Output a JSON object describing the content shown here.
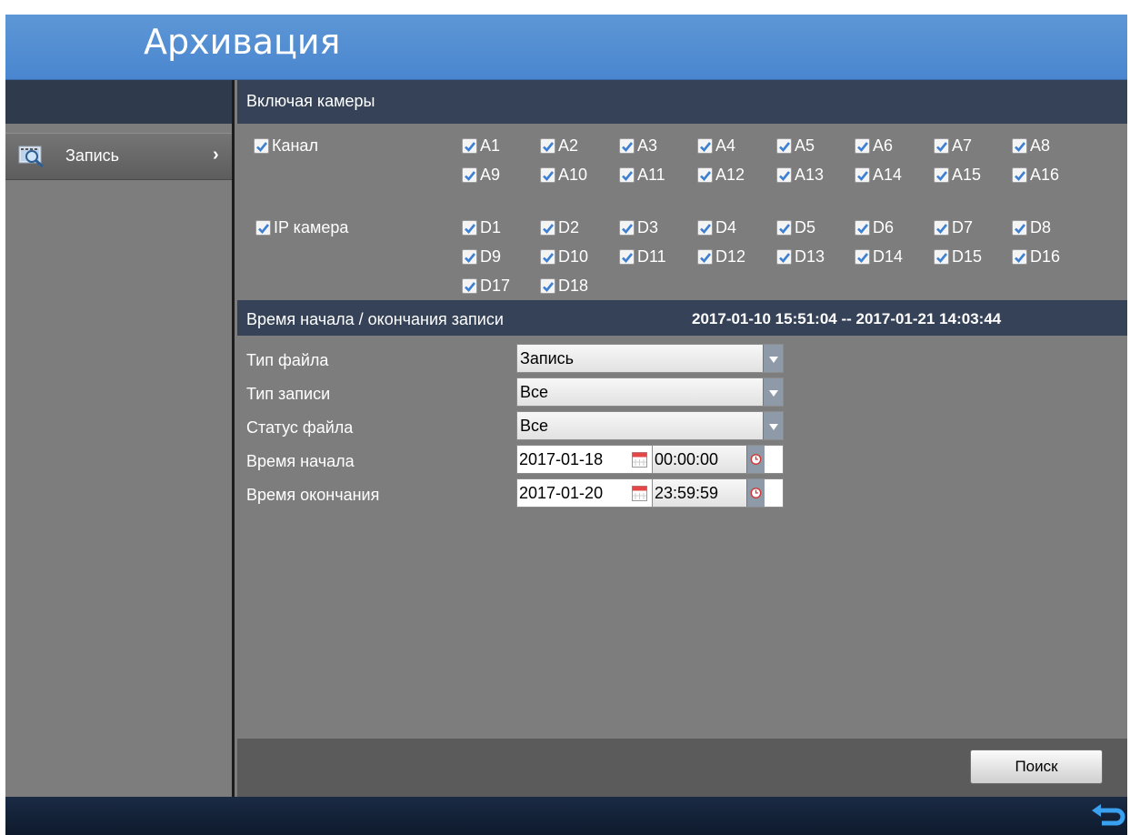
{
  "header": {
    "title": "Архивация"
  },
  "sidebar": {
    "items": [
      {
        "label": "Запись",
        "icon": "record-search-icon"
      }
    ]
  },
  "cameras": {
    "section_title": "Включая камеры",
    "channel": {
      "label": "Канал",
      "items": [
        "A1",
        "A2",
        "A3",
        "A4",
        "A5",
        "A6",
        "A7",
        "A8",
        "A9",
        "A10",
        "A11",
        "A12",
        "A13",
        "A14",
        "A15",
        "A16"
      ]
    },
    "ip": {
      "label": "IP камера",
      "items": [
        "D1",
        "D2",
        "D3",
        "D4",
        "D5",
        "D6",
        "D7",
        "D8",
        "D9",
        "D10",
        "D11",
        "D12",
        "D13",
        "D14",
        "D15",
        "D16",
        "D17",
        "D18"
      ]
    }
  },
  "record_time": {
    "section_title": "Время начала / окончания записи",
    "range": "2017-01-10 15:51:04  --  2017-01-21 14:03:44"
  },
  "form": {
    "file_type": {
      "label": "Тип файла",
      "value": "Запись"
    },
    "record_type": {
      "label": "Тип записи",
      "value": "Все"
    },
    "file_status": {
      "label": "Статус файла",
      "value": "Все"
    },
    "start_time": {
      "label": "Время начала",
      "date": "2017-01-18",
      "time": "00:00:00"
    },
    "end_time": {
      "label": "Время окончания",
      "date": "2017-01-20",
      "time": "23:59:59"
    }
  },
  "actions": {
    "search": "Поиск"
  },
  "colors": {
    "title_bar": "#4a86cf",
    "section_header": "#354257",
    "panel": "#7d7d7d",
    "bottom_bar": "#0e1a2d",
    "check": "#3d7fd1"
  }
}
